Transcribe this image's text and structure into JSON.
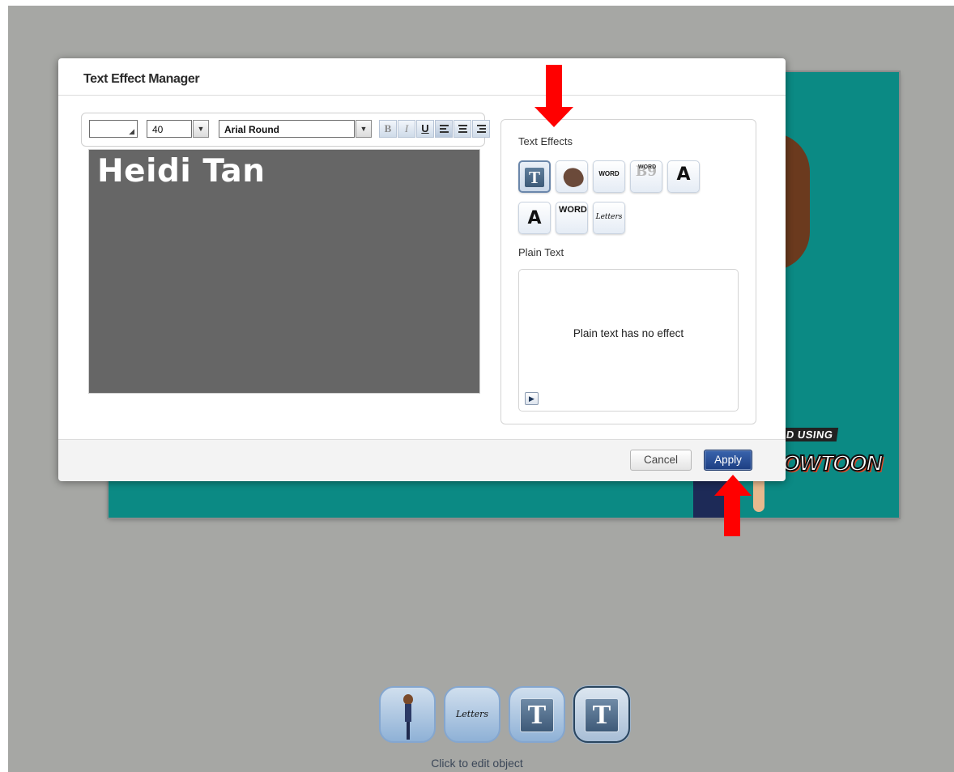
{
  "dialog": {
    "title": "Text Effect Manager",
    "cancel_label": "Cancel",
    "apply_label": "Apply"
  },
  "toolbar": {
    "font_size": "40",
    "font_family": "Arial Round",
    "bold_label": "B",
    "italic_label": "I",
    "underline_label": "U",
    "text_color": "#ffffff"
  },
  "editor": {
    "text": "Heidi Tan",
    "background_color": "#666666"
  },
  "effects_panel": {
    "section_label": "Text Effects",
    "effects": [
      {
        "label": "T",
        "icon": "plain-text-icon",
        "selected": true
      },
      {
        "label": "",
        "icon": "hand-draw-icon",
        "selected": false
      },
      {
        "label": "WORD",
        "icon": "word-effect-icon",
        "selected": false
      },
      {
        "label": "WORD",
        "sub": "B9",
        "icon": "word-fade-icon",
        "selected": false
      },
      {
        "label": "A",
        "icon": "letter-pop-icon",
        "selected": false
      },
      {
        "label": "A",
        "icon": "letter-bounce-icon",
        "selected": false
      },
      {
        "label": "WORD",
        "icon": "word-slide-icon",
        "selected": false
      },
      {
        "label": "Letters",
        "icon": "letters-effect-icon",
        "selected": false
      }
    ],
    "selected_effect_label": "Plain Text",
    "preview_text": "Plain text has no effect"
  },
  "canvas": {
    "badge_text": "D USING",
    "logo_text": "OWTOON",
    "background_color": "#0b8a84"
  },
  "object_bar": {
    "items": [
      {
        "icon": "character-icon",
        "label": ""
      },
      {
        "icon": "letters-icon",
        "label": "Letters"
      },
      {
        "icon": "text-object-icon",
        "label": "T"
      },
      {
        "icon": "text-object-icon",
        "label": "T",
        "active": true
      }
    ],
    "hint": "Click to edit object"
  },
  "annotations": {
    "arrow_color": "#ff0000"
  }
}
